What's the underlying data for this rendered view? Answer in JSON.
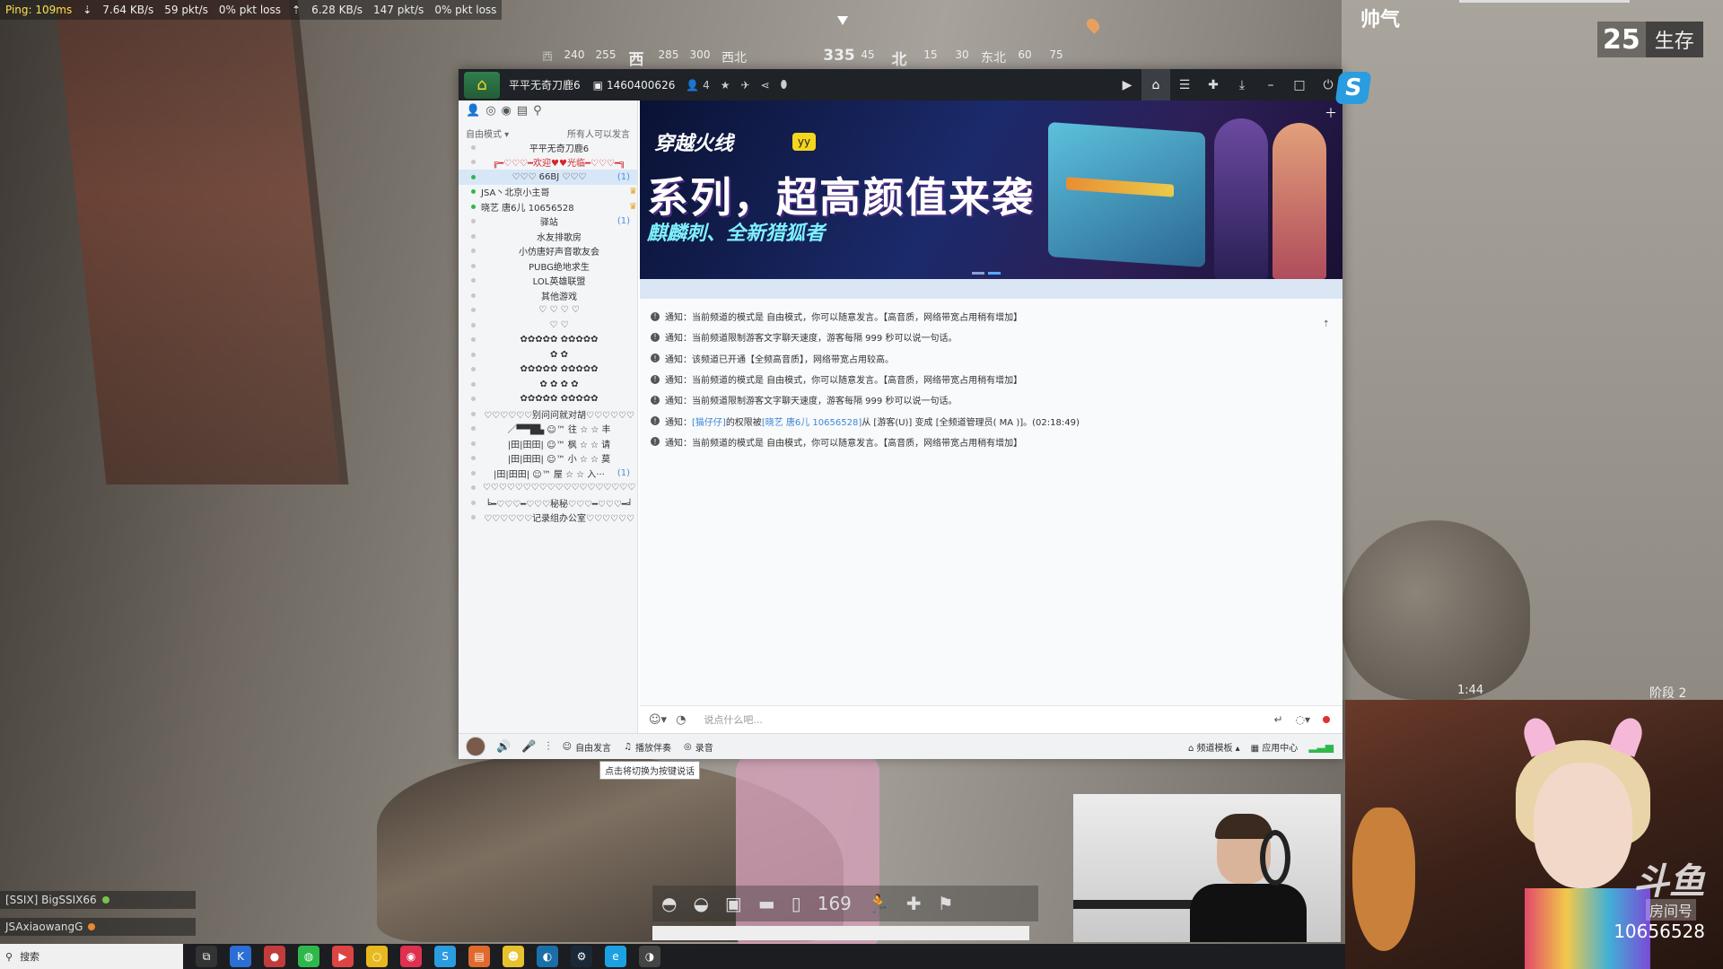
{
  "hud": {
    "ping": "Ping: 109ms",
    "down": "7.64 KB/s",
    "down_pkt": "59 pkt/s",
    "down_loss": "0% pkt loss",
    "up": "6.28 KB/s",
    "up_pkt": "147 pkt/s",
    "up_loss": "0% pkt loss",
    "compass": [
      "西",
      "240",
      "255",
      "西",
      "285",
      "300",
      "西北",
      "335",
      "45",
      "北",
      "15",
      "30",
      "东北",
      "60",
      "75"
    ],
    "player_tag": "帅气",
    "alive_count": "25",
    "alive_label": "生存",
    "timer": "1:44",
    "stage": "阶段 2",
    "ammo": "169"
  },
  "window": {
    "channel_name": "平平无奇刀鹿6",
    "channel_id": "1460400626",
    "online_count": "4"
  },
  "sidebar": {
    "mode": "自由模式",
    "mode_hint": "所有人可以发言",
    "items": [
      {
        "text": "平平无奇刀鹿6",
        "style": "root"
      },
      {
        "text": "╔━♡♡♡━欢迎♥♥光临━♡♡♡━╗",
        "style": "red"
      },
      {
        "text": "♡♡♡ 66BJ ♡♡♡",
        "style": "sel",
        "count": "(1)"
      },
      {
        "text": "JSA丶北京小主哥",
        "style": "user"
      },
      {
        "text": "晓艺 唐6儿 10656528",
        "style": "user"
      },
      {
        "text": "驿站",
        "style": "",
        "count": "(1)"
      },
      {
        "text": "水友排歌房",
        "style": ""
      },
      {
        "text": "小仿唐好声音歌友会",
        "style": ""
      },
      {
        "text": "PUBG绝地求生",
        "style": ""
      },
      {
        "text": "LOL英雄联盟",
        "style": ""
      },
      {
        "text": "其他游戏",
        "style": ""
      },
      {
        "text": "♡ ♡ ♡ ♡",
        "style": ""
      },
      {
        "text": "♡ ♡",
        "style": ""
      },
      {
        "text": "✿✿✿✿✿ ✿✿✿✿✿",
        "style": ""
      },
      {
        "text": "✿ ✿",
        "style": ""
      },
      {
        "text": "✿✿✿✿✿ ✿✿✿✿✿",
        "style": ""
      },
      {
        "text": "✿ ✿ ✿ ✿",
        "style": ""
      },
      {
        "text": "✿✿✿✿✿ ✿✿✿✿✿",
        "style": ""
      },
      {
        "text": "♡♡♡♡♡♡别问问就对胡♡♡♡♡♡♡",
        "style": ""
      },
      {
        "text": "／▀▀█▙ ☺™ 往 ☆ ☆ 丰",
        "style": ""
      },
      {
        "text": "|田|田田| ☺™ 枫 ☆ ☆ 请",
        "style": ""
      },
      {
        "text": "|田|田田| ☺™ 小 ☆ ☆ 莫",
        "style": ""
      },
      {
        "text": "|田|田田| ☺™ 屋 ☆ ☆ 入···",
        "style": "",
        "count": "(1)"
      },
      {
        "text": "♡♡♡♡♡♡♡♡♡♡♡♡♡♡♡♡♡♡♡",
        "style": ""
      },
      {
        "text": "╘━♡♡♡━♡♡♡秘秘♡♡♡━♡♡♡━╛",
        "style": ""
      },
      {
        "text": "♡♡♡♡♡♡记录组办公室♡♡♡♡♡♡",
        "style": ""
      }
    ]
  },
  "banner": {
    "brand": "穿越火线",
    "brand_badge": "yy",
    "title": "系列，超高颜值来袭",
    "subtitle": "麒麟刺、全新猎狐者"
  },
  "messages": [
    {
      "text": "通知：当前频道的模式是 自由模式，你可以随意发言。【高音质，网络带宽占用稍有增加】"
    },
    {
      "text": "通知：当前频道限制游客文字聊天速度，游客每隔 999 秒可以说一句话。"
    },
    {
      "text": "通知：该频道已开通【全频高音质】，网络带宽占用较高。"
    },
    {
      "text": "通知：当前频道的模式是 自由模式，你可以随意发言。【高音质，网络带宽占用稍有增加】"
    },
    {
      "text": "通知：当前频道限制游客文字聊天速度，游客每隔 999 秒可以说一句话。"
    },
    {
      "pre": "通知：",
      "link1": "[猫仔仔]",
      "mid": " 的权限被 ",
      "link2": "[晓艺 唐6儿 10656528]",
      "post": " 从 [游客(U)] 变成 [全频道管理员( MA )]。(02:18:49)"
    },
    {
      "text": "通知：当前频道的模式是 自由模式，你可以随意发言。【高音质，网络带宽占用稍有增加】"
    }
  ],
  "input": {
    "placeholder": "说点什么吧..."
  },
  "bottombar": {
    "free_speak": "自由发言",
    "accompany": "播放伴奏",
    "record": "录音",
    "channel_template": "频道模板",
    "app_center": "应用中心",
    "tooltip": "点击将切换为按键说话"
  },
  "killfeed": [
    "[SSIX] BigSSIX66",
    "JSAxiaowangG"
  ],
  "cam2": {
    "watermark": "斗鱼",
    "watermark_sub": "房间号",
    "room_id": "10656528"
  },
  "taskbar": {
    "search": "搜索"
  }
}
